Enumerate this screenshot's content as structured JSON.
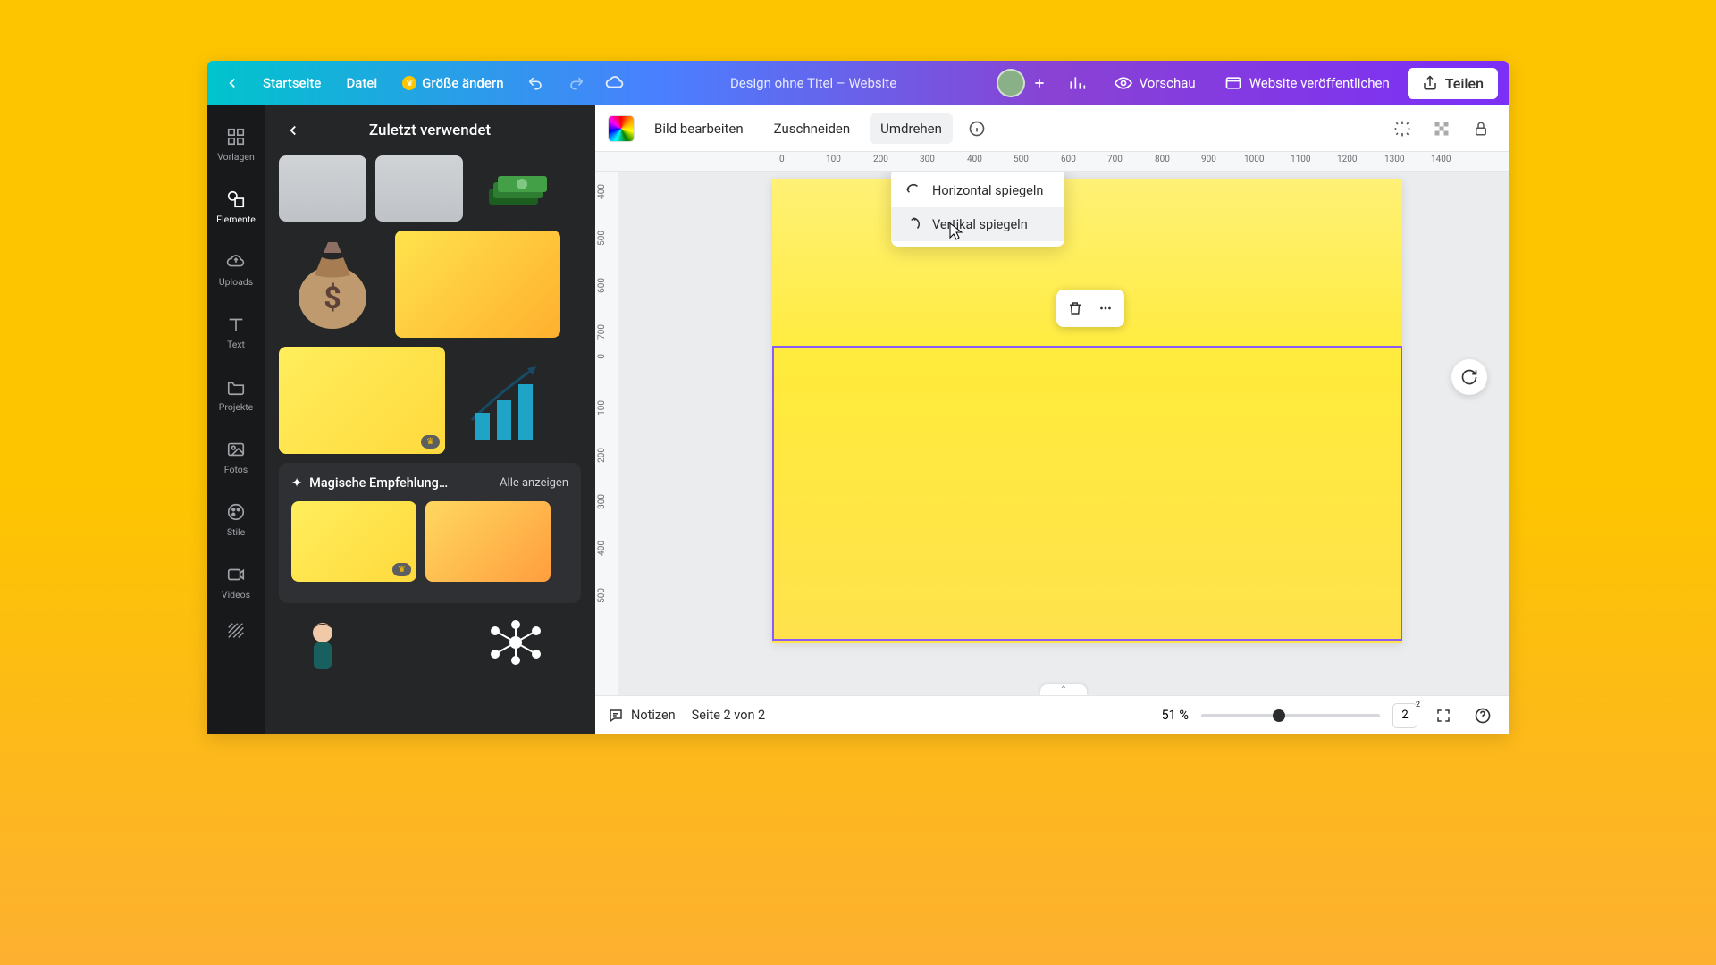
{
  "header": {
    "home": "Startseite",
    "file": "Datei",
    "resize": "Größe ändern",
    "title": "Design ohne Titel – Website",
    "preview": "Vorschau",
    "publish": "Website veröffentlichen",
    "share": "Teilen"
  },
  "rail": {
    "templates": "Vorlagen",
    "elements": "Elemente",
    "uploads": "Uploads",
    "text": "Text",
    "projects": "Projekte",
    "photos": "Fotos",
    "styles": "Stile",
    "videos": "Videos"
  },
  "panel": {
    "title": "Zuletzt verwendet",
    "rec_title": "Magische Empfehlung…",
    "rec_all": "Alle anzeigen"
  },
  "ctx": {
    "edit_image": "Bild bearbeiten",
    "crop": "Zuschneiden",
    "flip": "Umdrehen"
  },
  "flip_menu": {
    "horizontal": "Horizontal spiegeln",
    "vertical": "Vertikal spiegeln"
  },
  "ruler_h": [
    "0",
    "100",
    "200",
    "300",
    "400",
    "500",
    "600",
    "700",
    "800",
    "900",
    "1000",
    "1100",
    "1200",
    "1300",
    "1400"
  ],
  "ruler_v": [
    "400",
    "500",
    "600",
    "700",
    "0",
    "100",
    "200",
    "300",
    "400",
    "500"
  ],
  "footer": {
    "notes": "Notizen",
    "page_info": "Seite 2 von 2",
    "zoom": "51 %",
    "page_count": "2"
  }
}
